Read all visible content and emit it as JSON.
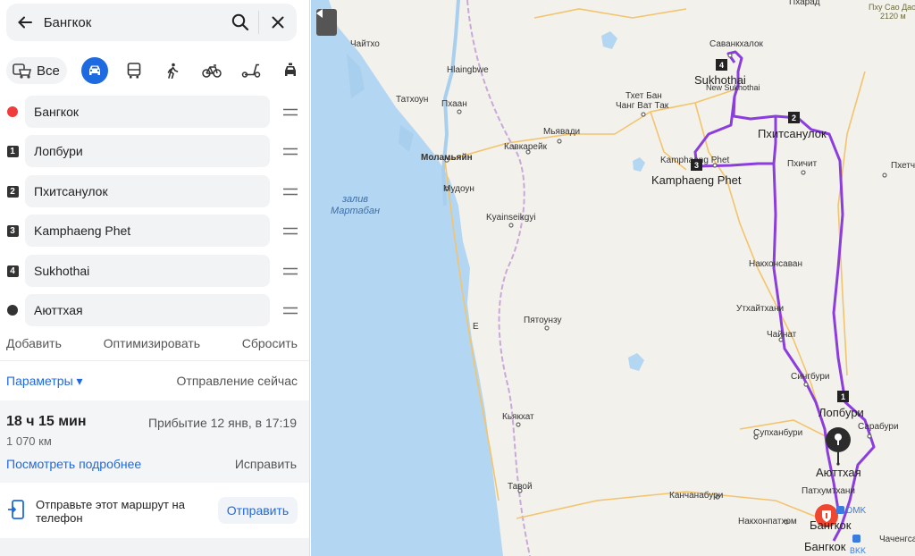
{
  "search": {
    "query": "Бангкок"
  },
  "modes": {
    "all_label": "Все"
  },
  "waypoints": [
    {
      "label": "Бангкок",
      "marker": ""
    },
    {
      "label": "Лопбури",
      "marker": "1"
    },
    {
      "label": "Пхитсанулок",
      "marker": "2"
    },
    {
      "label": "Kamphaeng Phet",
      "marker": "3"
    },
    {
      "label": "Sukhothai",
      "marker": "4"
    },
    {
      "label": "Аюттхая",
      "marker": ""
    }
  ],
  "actions": {
    "add": "Добавить",
    "optimize": "Оптимизировать",
    "reset": "Сбросить"
  },
  "params": {
    "label": "Параметры ▾",
    "departure": "Отправление сейчас"
  },
  "summary": {
    "duration": "18 ч 15 мин",
    "arrival": "Прибытие 12 янв, в 17:19",
    "distance": "1 070 км",
    "details_link": "Посмотреть подробнее",
    "fix_link": "Исправить"
  },
  "share": {
    "text": "Отправьте этот маршрут на телефон",
    "button": "Отправить"
  },
  "map": {
    "labels": {
      "chaiton": "Чайтхо",
      "hlaingbwe": "Hlaingbwe",
      "tathon": "Татхоун",
      "phaan": "Пхаан",
      "mawlamyine": "Моламьяйн",
      "mudon": "Мудоун",
      "kyainseikgyi": "Kyainseikgyi",
      "kawkareik": "Кавкарейк",
      "myawaddy": "Мьявади",
      "chang_wat_tak": "Чанг Ват Так",
      "thet_ban": "Тхет Бан",
      "sawankhalok": "Саванкхалок",
      "sukhothai": "Sukhothai",
      "new_sukhothai": "New Sukhothai",
      "phitsanulok": "Пхитсанулок",
      "kamphaeng_small": "Kamphaeng Phet",
      "kamphaeng_big": "Kamphaeng Phet",
      "phichit": "Пхичит",
      "nakhonsawan": "Накхонсаван",
      "uthaithani": "Утхайтхани",
      "chainat": "Чайнат",
      "singburi": "Сингбури",
      "lopburi": "Лопбури",
      "saraburi": "Сарабури",
      "suphanburi": "Супханбури",
      "ayutthaya": "Аюттхая",
      "pathumthani": "Патхумтхани",
      "kanchanaburi": "Канчанабури",
      "nakhonpathom": "Накхонпатхом",
      "bangkok": "Бангкок",
      "bangkok2": "Бангкок",
      "dmk": "DMK",
      "bkk": "BKK",
      "chachoengsao": "Чаченгсао",
      "payatonzu": "Пятоунзу",
      "kyaikkhat": "Кьякхат",
      "tavoy": "Тавой",
      "e": "Е",
      "bay_line1": "залив",
      "bay_line2": "Мартабан",
      "phetchabun_frag": "Пхетча",
      "phu_soi_dao": "Пху Сао Дао",
      "elevation": "2120 м",
      "pharad": "Пхарад"
    },
    "route_markers": {
      "m1": "1",
      "m2": "2",
      "m3": "3",
      "m4": "4"
    },
    "colors": {
      "route": "#8b3dde",
      "water": "#b3d6f2",
      "road": "#f2c46d",
      "border": "#c9a9d8"
    }
  }
}
